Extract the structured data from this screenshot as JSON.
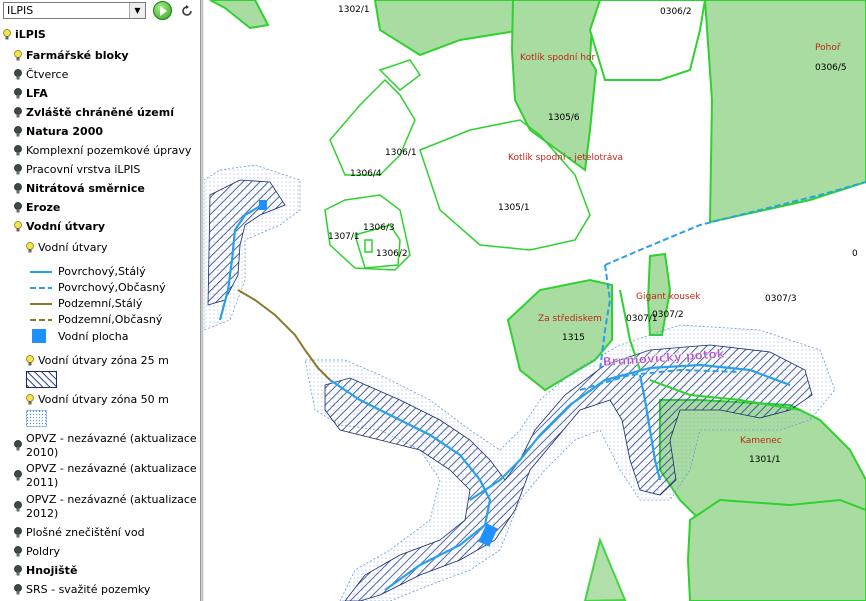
{
  "toolbar": {
    "layer_select_value": "ILPIS"
  },
  "layers": {
    "root": "iLPIS",
    "farm_blocks": "Farmářské bloky",
    "squares": "Čtverce",
    "lfa": "LFA",
    "protected": "Zvláště chráněné území",
    "natura": "Natura 2000",
    "land_adjust": "Komplexní pozemkové úpravy",
    "work_layer": "Pracovní vrstva iLPIS",
    "nitrate": "Nitrátová směrnice",
    "erosion": "Eroze",
    "water": "Vodní útvary",
    "water_sub": "Vodní útvary",
    "legend": {
      "surface_perm": "Povrchový,Stálý",
      "surface_occ": "Povrchový,Občasný",
      "under_perm": "Podzemní,Stálý",
      "under_occ": "Podzemní,Občasný",
      "water_area": "Vodní plocha"
    },
    "zone25": "Vodní útvary zóna 25 m",
    "zone50": "Vodní útvary zóna 50 m",
    "opvz2010": "OPVZ - nezávazné (aktualizace 2010)",
    "opvz2011": "OPVZ - nezávazné (aktualizace 2011)",
    "opvz2012": "OPVZ - nezávazné (aktualizace 2012)",
    "pollution": "Plošné znečištění vod",
    "polders": "Poldry",
    "fertilizer": "Hnojiště",
    "srs": "SRS - svažité pozemky"
  },
  "map_labels": {
    "p1302_1": "1302/1",
    "p0306_2": "0306/2",
    "p0306_5": "0306/5",
    "kotlik_hor": "Kotlík spodní hor",
    "pohori": "Pohoř",
    "p1305_6": "1305/6",
    "p1306_1": "1306/1",
    "kotlik_jet": "Kotlík spodní - jetelotráva",
    "p1306_4": "1306/4",
    "p1305_1": "1305/1",
    "p1306_3": "1306/3",
    "p1307_1": "1307/1",
    "p1306_2": "1306/2",
    "p0307_3": "0307/3",
    "gigant": "Gigant kousek",
    "za_strediskem": "Za střediskem",
    "p0307_1": "0307/1",
    "p0307_2": "0307/2",
    "p1315": "1315",
    "stream": "Brumovický potok",
    "kamenec": "Kamenec",
    "p1301_1": "1301/1",
    "edge_0": "0"
  },
  "colors": {
    "parcel_fill": "#a8dca0",
    "parcel_stroke": "#2fd12f",
    "stream": "#2aa0e8",
    "underground": "#8b7a2c",
    "zone25": "#2a3e8c",
    "label_red": "#c0281c"
  }
}
